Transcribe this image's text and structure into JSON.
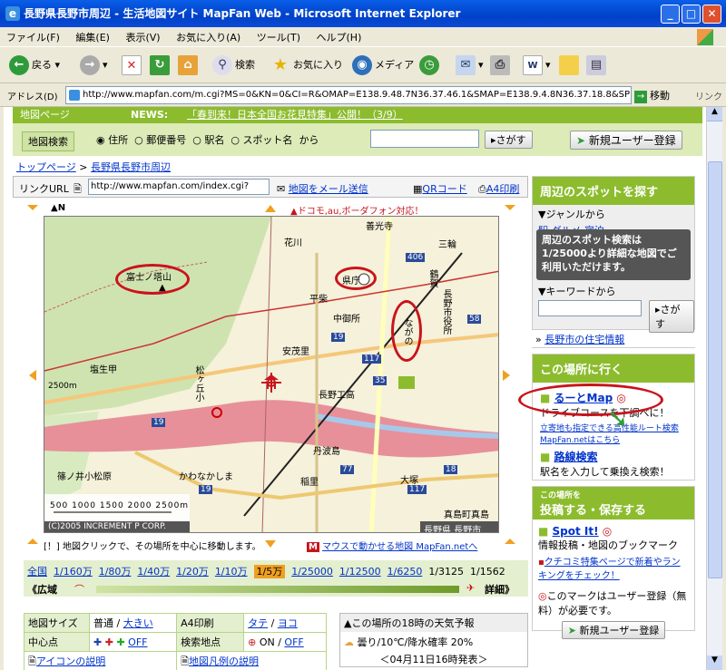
{
  "window": {
    "title": "長野県長野市周辺 - 生活地図サイト MapFan Web - Microsoft Internet Explorer"
  },
  "menu": [
    "ファイル(F)",
    "編集(E)",
    "表示(V)",
    "お気に入り(A)",
    "ツール(T)",
    "ヘルプ(H)"
  ],
  "toolbar": {
    "back": "戻る",
    "search": "検索",
    "favorites": "お気に入り",
    "media": "メディア"
  },
  "address": {
    "label": "アドレス(D)",
    "url": "http://www.mapfan.com/m.cgi?MS=0&KN=0&CI=R&OMAP=E138.9.48.7N36.37.46.1&SMAP=E138.9.4.8N36.37.18.8&SP=1&",
    "go": "移動",
    "links": "リンク"
  },
  "page": {
    "header_left": "地図ページ",
    "news_label": "NEWS:",
    "news_text": "「春到来！日本全国お花見特集」公開！（3/9）",
    "search": {
      "label": "地図検索",
      "options": [
        "住所",
        "郵便番号",
        "駅名",
        "スポット名"
      ],
      "from": "から",
      "button": "さがす",
      "register": "新規ユーザー登録"
    },
    "breadcrumb": {
      "top": "トップページ",
      "sep": ">",
      "current": "長野県長野市周辺"
    },
    "link_url": {
      "label": "リンクURL",
      "value": "http://www.mapfan.com/index.cgi?",
      "mail": "地図をメール送信",
      "qr": "QRコード",
      "print": "A4印刷"
    },
    "map": {
      "north": "▲N",
      "docomo": "▲ドコモ,au,ボーダフォン対応！",
      "copyright": "(C)2005 INCREMENT P CORP.",
      "location": "長野県 長野市",
      "scale_bar": "2500m",
      "scale_ticks": [
        "500",
        "1000",
        "1500",
        "2000",
        "2500m"
      ],
      "labels": [
        "富士ノ塔山",
        "県庁",
        "ながの",
        "善光寺",
        "花川",
        "三輪",
        "鶴賀",
        "長野市役所",
        "平柴",
        "中御所",
        "安茂里",
        "塩生甲",
        "松ヶ丘小",
        "長野工高",
        "丹波島",
        "稲里",
        "大塚",
        "篠ノ井小松原",
        "かわなかしま",
        "真島町真島",
        "長野県 長野市",
        "406",
        "19",
        "117",
        "35",
        "77",
        "18",
        "58",
        "117",
        "19",
        "19"
      ]
    },
    "map_note": "[！] 地図クリックで、その場所を中心に移動します。",
    "mouse_link": "マウスで動かせる地図 MapFan.netへ",
    "scales": [
      "全国",
      "1/160万",
      "1/80万",
      "1/40万",
      "1/20万",
      "1/10万",
      "1/5万",
      "1/25000",
      "1/12500",
      "1/6250",
      "1/3125",
      "1/1562"
    ],
    "zoom": {
      "wide": "《広域",
      "detail": "詳細》"
    },
    "bottom": {
      "size_label": "地図サイズ",
      "size_normal": "普通 /",
      "size_large": "大きい",
      "a4_label": "A4印刷",
      "a4_tate": "タテ",
      "a4_sep": "/",
      "a4_yoko": "ヨコ",
      "center_label": "中心点",
      "center_off": "OFF",
      "spot_label": "検索地点",
      "spot_on": "ON /",
      "spot_off": "OFF",
      "icon_legend": "アイコンの説明",
      "map_legend": "地図凡例の説明"
    },
    "weather": {
      "title": "▲この場所の18時の天気予報",
      "text": "曇り/10℃/降水確率 20%",
      "issued": "＜04月11日16時発表＞"
    },
    "side": {
      "nearby_title": "周辺のスポットを探す",
      "genre": "▼ジャンルから",
      "genre_items": [
        "駅",
        "グルメ",
        "宿泊"
      ],
      "tooltip": "周辺のスポット検索は1/25000より詳細な地図でご利用いただけます。",
      "keyword": "▼キーワードから",
      "keyword_btn": "さがす",
      "housing": "長野市の住宅情報",
      "goto_title": "この場所に行く",
      "route_map": "るーとMap",
      "route_desc": "ドライブコースを下調べに！",
      "route_sub": "立寄地も指定できる高性能ルート検索 MapFan.netはこちら",
      "transit": "路線検索",
      "transit_desc": "駅名を入力して乗換え検索！",
      "post_small": "この場所を",
      "post_title": "投稿する・保存する",
      "spot_it": "Spot It!",
      "spot_desc": "情報投稿・地図のブックマーク",
      "kuchikomi": "クチコミ特集ページで新着やランキングをチェック！",
      "note": "このマークはユーザー登録（無料）が必要です。",
      "register": "新規ユーザー登録"
    }
  },
  "colors": {
    "green": "#8cbc2e",
    "light_green": "#dcebb8",
    "red_ring": "#c8141c",
    "river": "#e7909a",
    "link": "#0033cc"
  }
}
